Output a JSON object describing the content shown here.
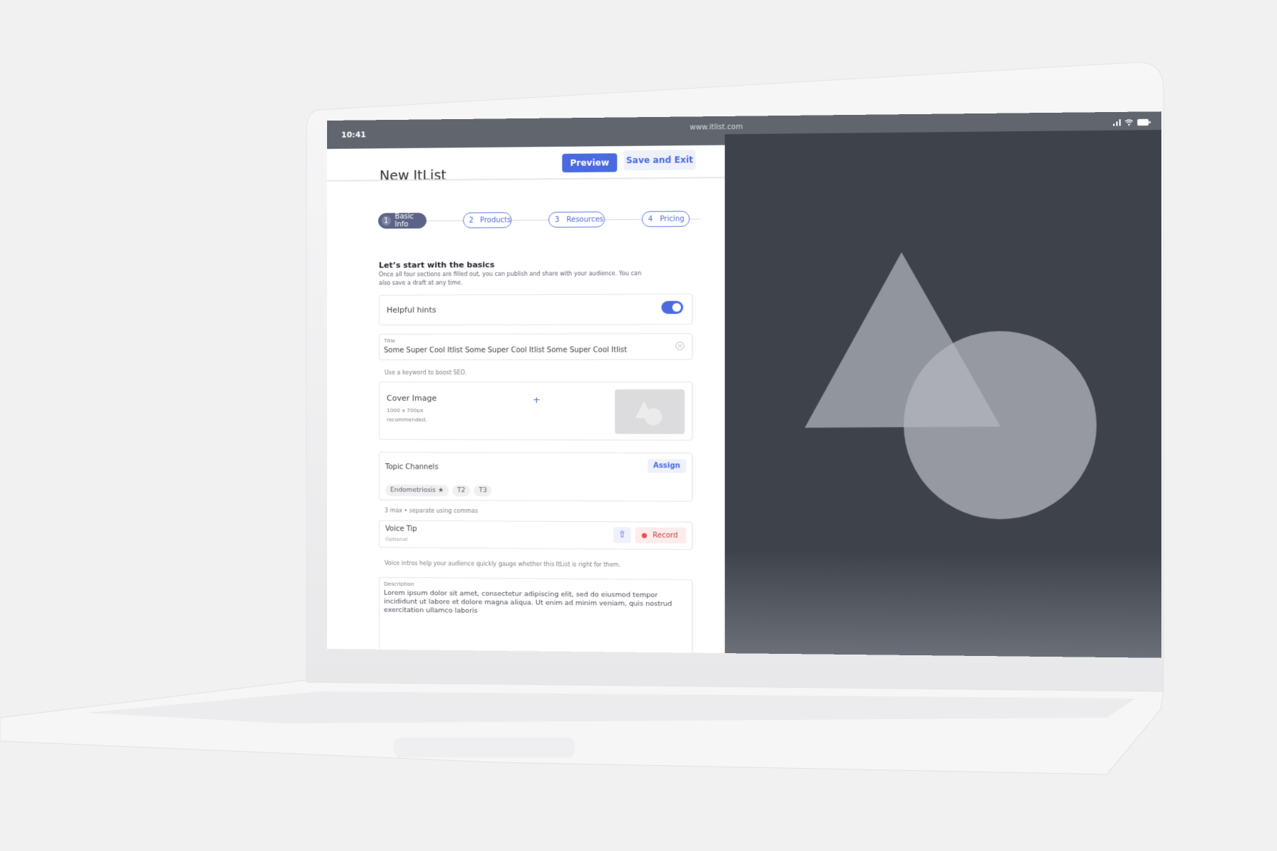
{
  "status_bar": {
    "time": "10:41",
    "url": "www.itlist.com",
    "icons": [
      "signal-icon",
      "wifi-icon",
      "battery-icon"
    ]
  },
  "header": {
    "title": "New ItList",
    "preview_label": "Preview",
    "save_label": "Save and Exit"
  },
  "steps": [
    {
      "number": "1",
      "label": "Basic Info",
      "active": true
    },
    {
      "number": "2",
      "label": "Products",
      "active": false
    },
    {
      "number": "3",
      "label": "Resources",
      "active": false
    },
    {
      "number": "4",
      "label": "Pricing",
      "active": false
    }
  ],
  "intro": {
    "heading": "Let’s start with the basics",
    "text": "Once all four sections are filled out, you can publish and share with your audience.  You can also  save a draft at any time."
  },
  "hints": {
    "label": "Helpful hints",
    "enabled": true
  },
  "title_field": {
    "label": "Title",
    "value": "Some Super Cool Itlist Some Super Cool Itlist Some Super Cool Itlist",
    "helper": "Use a keyword to boost SEO."
  },
  "cover": {
    "label": "Cover Image",
    "size": "1000 x 700px",
    "note": "recommended.",
    "add_icon": "+"
  },
  "topics": {
    "label": "Topic Channels",
    "assign_label": "Assign",
    "chips": [
      "Endometriosis ★",
      "T2",
      "T3"
    ],
    "helper": "3 max • separate using commas"
  },
  "voice": {
    "label": "Voice Tip",
    "optional": "Optional",
    "upload_icon": "⇧",
    "record_label": "Record",
    "helper": "Voice intros help your audience quickly gauge whether this ItList is right for them."
  },
  "description": {
    "label": "Description",
    "value": "Lorem ipsum dolor sit amet, consectetur adipiscing elit, sed do eiusmod tempor incididunt ut labore et dolore magna aliqua. Ut enim ad minim veniam, quis nostrud exercitation ullamco laboris"
  },
  "colors": {
    "accent": "#4a6ae0",
    "record": "#ee4b52",
    "preview_panel": "#3e424b"
  }
}
